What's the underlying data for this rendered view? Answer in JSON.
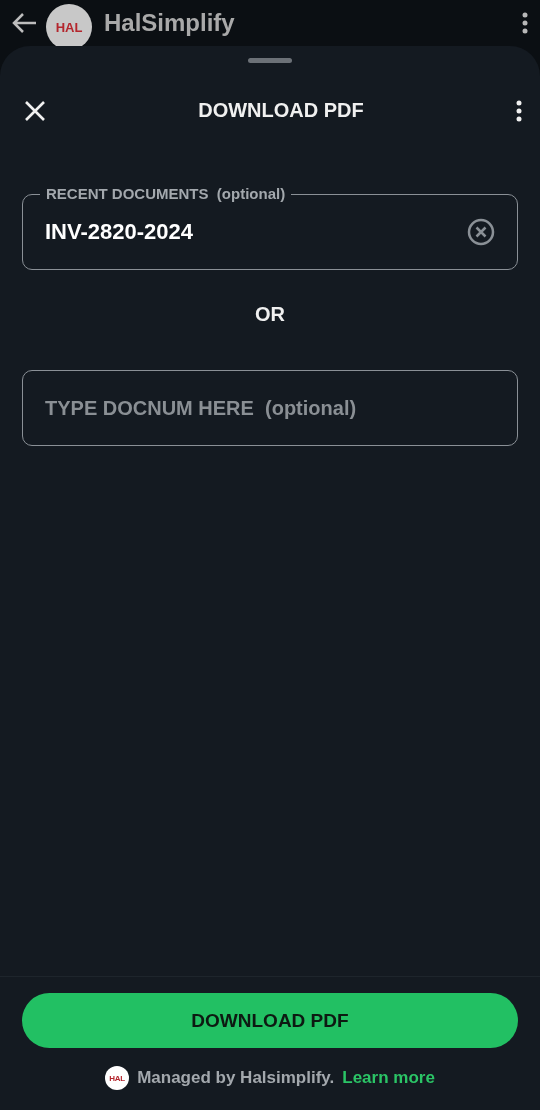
{
  "app_bar": {
    "logo": "HAL",
    "title": "HalSimplify"
  },
  "sheet": {
    "title": "DOWNLOAD PDF",
    "recent_field": {
      "label": "RECENT DOCUMENTS  (optional)",
      "value": "INV-2820-2024"
    },
    "separator": "OR",
    "docnum_field": {
      "placeholder": "TYPE DOCNUM HERE  (optional)"
    },
    "primary_button": "DOWNLOAD PDF",
    "footer": {
      "logo": "HAL",
      "text": "Managed by Halsimplify.",
      "link": "Learn more"
    }
  }
}
